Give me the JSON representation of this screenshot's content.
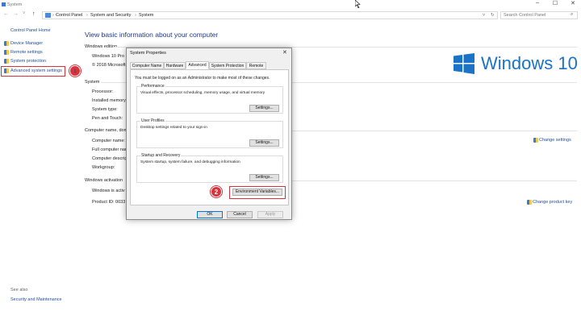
{
  "window": {
    "title": "System",
    "minimize": "–",
    "maximize": "☐",
    "close": "✕"
  },
  "address": {
    "back": "←",
    "forward": "→",
    "down": "˅",
    "up": "↑",
    "crumbs": [
      "Control Panel",
      "System and Security",
      "System"
    ],
    "sep": "›",
    "search_placeholder": "Search Control Panel"
  },
  "sidebar": {
    "home": "Control Panel Home",
    "items": [
      "Device Manager",
      "Remote settings",
      "System protection",
      "Advanced system settings"
    ],
    "see_also": "See also",
    "see_also_items": [
      "Security and Maintenance"
    ]
  },
  "steps": {
    "one": "1",
    "two": "2"
  },
  "main": {
    "heading": "View basic information about your computer",
    "edition_header": "Windows edition",
    "edition": "Windows 10 Pro",
    "copyright": "© 2018 Microsoft",
    "system_header": "System",
    "system_rows": [
      "Processor:",
      "Installed memory",
      "System type:",
      "Pen and Touch:"
    ],
    "computer_header": "Computer name, dom",
    "computer_rows": [
      "Computer name:",
      "Full computer nam",
      "Computer descript",
      "Workgroup:"
    ],
    "change_settings": "Change settings",
    "activation_header": "Windows activation",
    "activation_status": "Windows is activ",
    "product_id": "Product ID: 0033",
    "change_product_key": "Change product key",
    "brand": "Windows 10"
  },
  "dialog": {
    "title": "System Properties",
    "close": "✕",
    "tabs": [
      "Computer Name",
      "Hardware",
      "Advanced",
      "System Protection",
      "Remote"
    ],
    "active_tab": "Advanced",
    "note": "You must be logged on as an Administrator to make most of these changes.",
    "performance": {
      "title": "Performance",
      "desc": "Visual effects, processor scheduling, memory usage, and virtual memory",
      "button": "Settings..."
    },
    "profiles": {
      "title": "User Profiles",
      "desc": "Desktop settings related to your sign-in",
      "button": "Settings..."
    },
    "startup": {
      "title": "Startup and Recovery",
      "desc": "System startup, system failure, and debugging information",
      "button": "Settings..."
    },
    "env_button": "Environment Variables...",
    "ok": "OK",
    "cancel": "Cancel",
    "apply": "Apply"
  },
  "colors": {
    "accent": "#1a73c7",
    "highlight": "#d9323b",
    "link": "#1f4e96"
  }
}
